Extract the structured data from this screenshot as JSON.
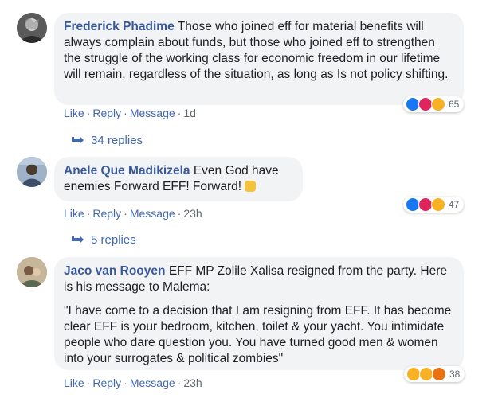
{
  "comments": [
    {
      "author": "Frederick Phadime",
      "text": "Those who joined eff for material benefits will always complain about funds, but those who joined eff to strengthen the struggle of the working class for economic freedom in our lifetime will remain, regardless of the situation, as long as Is not policy shifting.",
      "actions": {
        "like": "Like",
        "reply": "Reply",
        "message": "Message",
        "time": "1d"
      },
      "reactions": {
        "icons": [
          "like-reaction-icon",
          "haha-reaction-icon",
          "angry-reaction-icon"
        ],
        "count": "65"
      },
      "replies_label": "34 replies"
    },
    {
      "author": "Anele Que Madikizela",
      "text": "Even God have enemies Forward EFF! Forward!",
      "emoji": "raised-fist-emoji",
      "actions": {
        "like": "Like",
        "reply": "Reply",
        "message": "Message",
        "time": "23h"
      },
      "reactions": {
        "icons": [
          "like-reaction-icon",
          "haha-reaction-icon",
          "angry-reaction-icon"
        ],
        "count": "47"
      },
      "replies_label": "5 replies"
    },
    {
      "author": "Jaco van Rooyen",
      "text": "EFF MP Zolile Xalisa resigned from the party. Here is his message to Malema:",
      "quote": "\"I have come to a decision that I am resigning from EFF. It has become clear EFF is your bedroom, kitchen, toilet & your yacht. You intimidate people who dare question you. You have turned good men & women into your surrogates & political zombies\"",
      "actions": {
        "like": "Like",
        "reply": "Reply",
        "message": "Message",
        "time": "23h"
      },
      "reactions": {
        "icons": [
          "wow-reaction-icon",
          "haha-reaction-icon",
          "angry-reaction-icon"
        ],
        "count": "38"
      }
    }
  ],
  "colors": {
    "author": "#385898",
    "link": "#4267b2",
    "bubble": "#f2f3f5",
    "meta": "#606770"
  }
}
